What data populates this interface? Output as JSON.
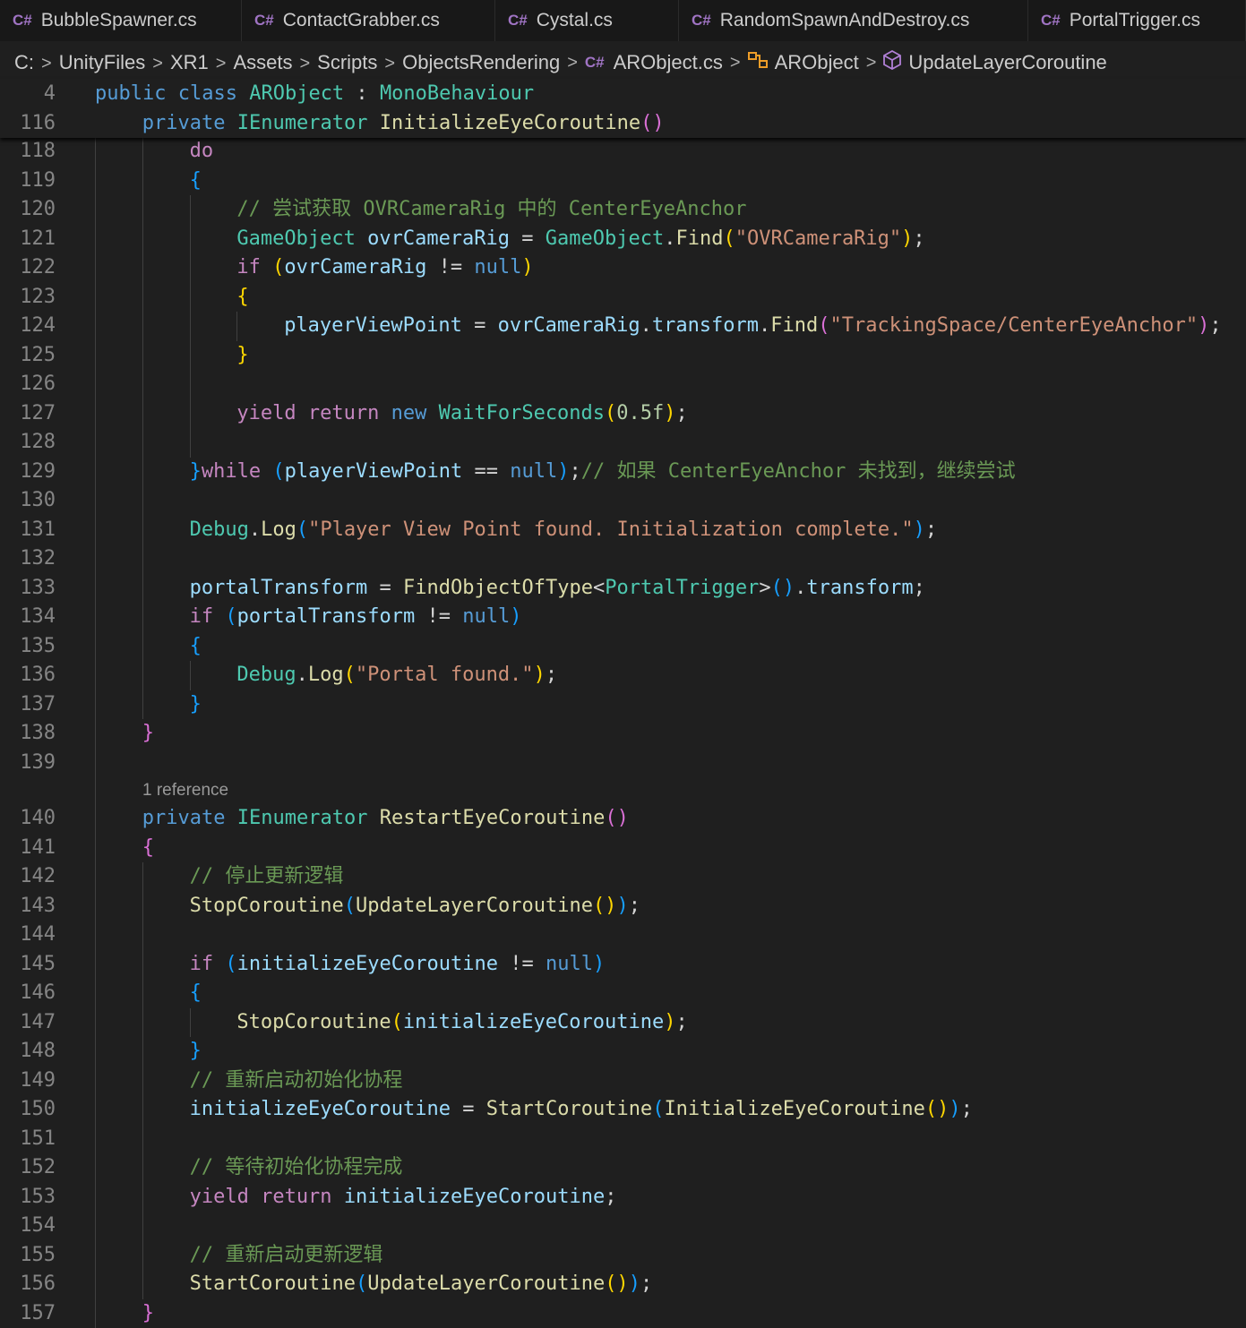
{
  "tabs": [
    {
      "label": "BubbleSpawner.cs",
      "icon": "csharp-file-icon"
    },
    {
      "label": "ContactGrabber.cs",
      "icon": "csharp-file-icon"
    },
    {
      "label": "Cystal.cs",
      "icon": "csharp-file-icon"
    },
    {
      "label": "RandomSpawnAndDestroy.cs",
      "icon": "csharp-file-icon"
    },
    {
      "label": "PortalTrigger.cs",
      "icon": "csharp-file-icon"
    }
  ],
  "breadcrumb": {
    "drive": "C:",
    "folders": [
      "UnityFiles",
      "XR1",
      "Assets",
      "Scripts",
      "ObjectsRendering"
    ],
    "file": "ARObject.cs",
    "class": "ARObject",
    "member": "UpdateLayerCoroutine"
  },
  "editor": {
    "reference_count": "1 reference",
    "lines": [
      {
        "n": "4",
        "indent": 0,
        "sticky": true,
        "tokens": [
          {
            "t": "public",
            "c": "kw"
          },
          {
            "t": " "
          },
          {
            "t": "class",
            "c": "kw"
          },
          {
            "t": " "
          },
          {
            "t": "ARObject",
            "c": "ty"
          },
          {
            "t": " : "
          },
          {
            "t": "MonoBehaviour",
            "c": "ty"
          }
        ]
      },
      {
        "n": "116",
        "indent": 1,
        "sticky": true,
        "tokens": [
          {
            "t": "private",
            "c": "kw"
          },
          {
            "t": " "
          },
          {
            "t": "IEnumerator",
            "c": "ty"
          },
          {
            "t": " "
          },
          {
            "t": "InitializeEyeCoroutine",
            "c": "fn"
          },
          {
            "t": "()",
            "c": "b2"
          }
        ]
      },
      {
        "n": "118",
        "indent": 2,
        "tokens": [
          {
            "t": "do",
            "c": "ctl"
          }
        ]
      },
      {
        "n": "119",
        "indent": 2,
        "tokens": [
          {
            "t": "{",
            "c": "b3"
          }
        ]
      },
      {
        "n": "120",
        "indent": 3,
        "tokens": [
          {
            "t": "// 尝试获取 OVRCameraRig 中的 CenterEyeAnchor",
            "c": "cm"
          }
        ]
      },
      {
        "n": "121",
        "indent": 3,
        "tokens": [
          {
            "t": "GameObject",
            "c": "ty"
          },
          {
            "t": " "
          },
          {
            "t": "ovrCameraRig",
            "c": "vr"
          },
          {
            "t": " = "
          },
          {
            "t": "GameObject",
            "c": "ty"
          },
          {
            "t": "."
          },
          {
            "t": "Find",
            "c": "fn"
          },
          {
            "t": "(",
            "c": "b1"
          },
          {
            "t": "\"OVRCameraRig\"",
            "c": "st"
          },
          {
            "t": ")",
            "c": "b1"
          },
          {
            "t": ";"
          }
        ]
      },
      {
        "n": "122",
        "indent": 3,
        "tokens": [
          {
            "t": "if",
            "c": "ctl"
          },
          {
            "t": " "
          },
          {
            "t": "(",
            "c": "b1"
          },
          {
            "t": "ovrCameraRig",
            "c": "vr"
          },
          {
            "t": " != "
          },
          {
            "t": "null",
            "c": "kw"
          },
          {
            "t": ")",
            "c": "b1"
          }
        ]
      },
      {
        "n": "123",
        "indent": 3,
        "tokens": [
          {
            "t": "{",
            "c": "b1"
          }
        ]
      },
      {
        "n": "124",
        "indent": 4,
        "tokens": [
          {
            "t": "playerViewPoint",
            "c": "vr"
          },
          {
            "t": " = "
          },
          {
            "t": "ovrCameraRig",
            "c": "vr"
          },
          {
            "t": "."
          },
          {
            "t": "transform",
            "c": "vr"
          },
          {
            "t": "."
          },
          {
            "t": "Find",
            "c": "fn"
          },
          {
            "t": "(",
            "c": "b2"
          },
          {
            "t": "\"TrackingSpace/CenterEyeAnchor\"",
            "c": "st"
          },
          {
            "t": ")",
            "c": "b2"
          },
          {
            "t": ";"
          }
        ]
      },
      {
        "n": "125",
        "indent": 3,
        "tokens": [
          {
            "t": "}",
            "c": "b1"
          }
        ]
      },
      {
        "n": "126",
        "indent": 3,
        "tokens": []
      },
      {
        "n": "127",
        "indent": 3,
        "tokens": [
          {
            "t": "yield",
            "c": "ctl"
          },
          {
            "t": " "
          },
          {
            "t": "return",
            "c": "ctl"
          },
          {
            "t": " "
          },
          {
            "t": "new",
            "c": "kw"
          },
          {
            "t": " "
          },
          {
            "t": "WaitForSeconds",
            "c": "ty"
          },
          {
            "t": "(",
            "c": "b1"
          },
          {
            "t": "0.5f",
            "c": "nm"
          },
          {
            "t": ")",
            "c": "b1"
          },
          {
            "t": ";"
          }
        ]
      },
      {
        "n": "128",
        "indent": 3,
        "tokens": []
      },
      {
        "n": "129",
        "indent": 2,
        "tokens": [
          {
            "t": "}",
            "c": "b3"
          },
          {
            "t": "while",
            "c": "ctl"
          },
          {
            "t": " "
          },
          {
            "t": "(",
            "c": "b3"
          },
          {
            "t": "playerViewPoint",
            "c": "vr"
          },
          {
            "t": " == "
          },
          {
            "t": "null",
            "c": "kw"
          },
          {
            "t": ")",
            "c": "b3"
          },
          {
            "t": ";"
          },
          {
            "t": "// 如果 CenterEyeAnchor 未找到，继续尝试",
            "c": "cm"
          }
        ]
      },
      {
        "n": "130",
        "indent": 2,
        "tokens": []
      },
      {
        "n": "131",
        "indent": 2,
        "tokens": [
          {
            "t": "Debug",
            "c": "ty"
          },
          {
            "t": "."
          },
          {
            "t": "Log",
            "c": "fn"
          },
          {
            "t": "(",
            "c": "b3"
          },
          {
            "t": "\"Player View Point found. Initialization complete.\"",
            "c": "st"
          },
          {
            "t": ")",
            "c": "b3"
          },
          {
            "t": ";"
          }
        ]
      },
      {
        "n": "132",
        "indent": 2,
        "tokens": []
      },
      {
        "n": "133",
        "indent": 2,
        "tokens": [
          {
            "t": "portalTransform",
            "c": "vr"
          },
          {
            "t": " = "
          },
          {
            "t": "FindObjectOfType",
            "c": "fn"
          },
          {
            "t": "<"
          },
          {
            "t": "PortalTrigger",
            "c": "ty"
          },
          {
            "t": ">"
          },
          {
            "t": "()",
            "c": "b3"
          },
          {
            "t": "."
          },
          {
            "t": "transform",
            "c": "vr"
          },
          {
            "t": ";"
          }
        ]
      },
      {
        "n": "134",
        "indent": 2,
        "tokens": [
          {
            "t": "if",
            "c": "ctl"
          },
          {
            "t": " "
          },
          {
            "t": "(",
            "c": "b3"
          },
          {
            "t": "portalTransform",
            "c": "vr"
          },
          {
            "t": " != "
          },
          {
            "t": "null",
            "c": "kw"
          },
          {
            "t": ")",
            "c": "b3"
          }
        ]
      },
      {
        "n": "135",
        "indent": 2,
        "tokens": [
          {
            "t": "{",
            "c": "b3"
          }
        ]
      },
      {
        "n": "136",
        "indent": 3,
        "tokens": [
          {
            "t": "Debug",
            "c": "ty"
          },
          {
            "t": "."
          },
          {
            "t": "Log",
            "c": "fn"
          },
          {
            "t": "(",
            "c": "b1"
          },
          {
            "t": "\"Portal found.\"",
            "c": "st"
          },
          {
            "t": ")",
            "c": "b1"
          },
          {
            "t": ";"
          }
        ]
      },
      {
        "n": "137",
        "indent": 2,
        "tokens": [
          {
            "t": "}",
            "c": "b3"
          }
        ]
      },
      {
        "n": "138",
        "indent": 1,
        "tokens": [
          {
            "t": "}",
            "c": "b2"
          }
        ]
      },
      {
        "n": "139",
        "indent": 1,
        "tokens": []
      },
      {
        "n": "lens",
        "lens": true
      },
      {
        "n": "140",
        "indent": 1,
        "tokens": [
          {
            "t": "private",
            "c": "kw"
          },
          {
            "t": " "
          },
          {
            "t": "IEnumerator",
            "c": "ty"
          },
          {
            "t": " "
          },
          {
            "t": "RestartEyeCoroutine",
            "c": "fn"
          },
          {
            "t": "()",
            "c": "b2"
          }
        ]
      },
      {
        "n": "141",
        "indent": 1,
        "tokens": [
          {
            "t": "{",
            "c": "b2"
          }
        ]
      },
      {
        "n": "142",
        "indent": 2,
        "tokens": [
          {
            "t": "// 停止更新逻辑",
            "c": "cm"
          }
        ]
      },
      {
        "n": "143",
        "indent": 2,
        "tokens": [
          {
            "t": "StopCoroutine",
            "c": "fn"
          },
          {
            "t": "(",
            "c": "b3"
          },
          {
            "t": "UpdateLayerCoroutine",
            "c": "fn"
          },
          {
            "t": "()",
            "c": "b1"
          },
          {
            "t": ")",
            "c": "b3"
          },
          {
            "t": ";"
          }
        ]
      },
      {
        "n": "144",
        "indent": 2,
        "tokens": []
      },
      {
        "n": "145",
        "indent": 2,
        "tokens": [
          {
            "t": "if",
            "c": "ctl"
          },
          {
            "t": " "
          },
          {
            "t": "(",
            "c": "b3"
          },
          {
            "t": "initializeEyeCoroutine",
            "c": "vr"
          },
          {
            "t": " != "
          },
          {
            "t": "null",
            "c": "kw"
          },
          {
            "t": ")",
            "c": "b3"
          }
        ]
      },
      {
        "n": "146",
        "indent": 2,
        "tokens": [
          {
            "t": "{",
            "c": "b3"
          }
        ]
      },
      {
        "n": "147",
        "indent": 3,
        "tokens": [
          {
            "t": "StopCoroutine",
            "c": "fn"
          },
          {
            "t": "(",
            "c": "b1"
          },
          {
            "t": "initializeEyeCoroutine",
            "c": "vr"
          },
          {
            "t": ")",
            "c": "b1"
          },
          {
            "t": ";"
          }
        ]
      },
      {
        "n": "148",
        "indent": 2,
        "tokens": [
          {
            "t": "}",
            "c": "b3"
          }
        ]
      },
      {
        "n": "149",
        "indent": 2,
        "tokens": [
          {
            "t": "// 重新启动初始化协程",
            "c": "cm"
          }
        ]
      },
      {
        "n": "150",
        "indent": 2,
        "tokens": [
          {
            "t": "initializeEyeCoroutine",
            "c": "vr"
          },
          {
            "t": " = "
          },
          {
            "t": "StartCoroutine",
            "c": "fn"
          },
          {
            "t": "(",
            "c": "b3"
          },
          {
            "t": "InitializeEyeCoroutine",
            "c": "fn"
          },
          {
            "t": "()",
            "c": "b1"
          },
          {
            "t": ")",
            "c": "b3"
          },
          {
            "t": ";"
          }
        ]
      },
      {
        "n": "151",
        "indent": 2,
        "tokens": []
      },
      {
        "n": "152",
        "indent": 2,
        "tokens": [
          {
            "t": "// 等待初始化协程完成",
            "c": "cm"
          }
        ]
      },
      {
        "n": "153",
        "indent": 2,
        "tokens": [
          {
            "t": "yield",
            "c": "ctl"
          },
          {
            "t": " "
          },
          {
            "t": "return",
            "c": "ctl"
          },
          {
            "t": " "
          },
          {
            "t": "initializeEyeCoroutine",
            "c": "vr"
          },
          {
            "t": ";"
          }
        ]
      },
      {
        "n": "154",
        "indent": 2,
        "tokens": []
      },
      {
        "n": "155",
        "indent": 2,
        "tokens": [
          {
            "t": "// 重新启动更新逻辑",
            "c": "cm"
          }
        ]
      },
      {
        "n": "156",
        "indent": 2,
        "tokens": [
          {
            "t": "StartCoroutine",
            "c": "fn"
          },
          {
            "t": "(",
            "c": "b3"
          },
          {
            "t": "UpdateLayerCoroutine",
            "c": "fn"
          },
          {
            "t": "()",
            "c": "b1"
          },
          {
            "t": ")",
            "c": "b3"
          },
          {
            "t": ";"
          }
        ]
      },
      {
        "n": "157",
        "indent": 1,
        "tokens": [
          {
            "t": "}",
            "c": "b2"
          }
        ]
      }
    ]
  }
}
